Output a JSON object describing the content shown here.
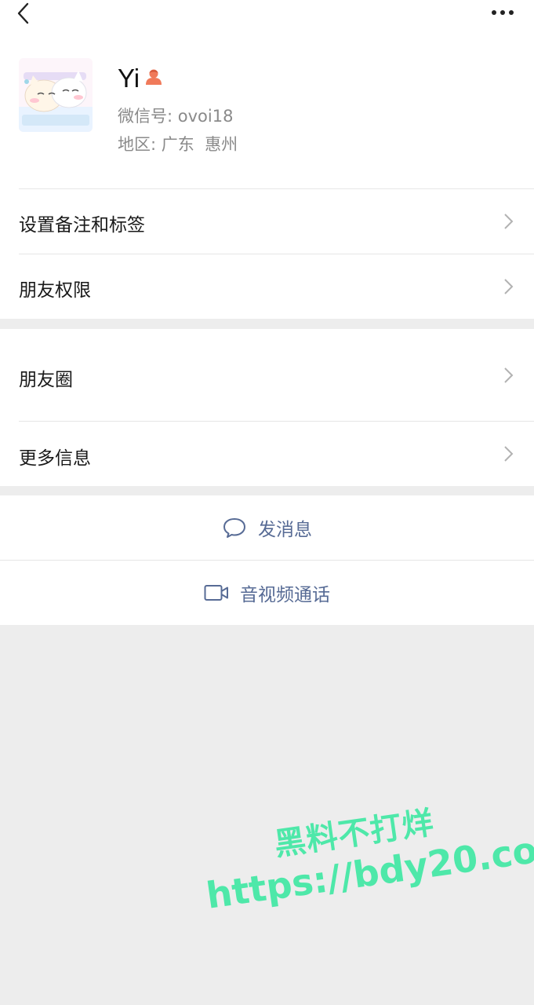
{
  "profile": {
    "name": "Yi",
    "wechat_id_label": "微信号:",
    "wechat_id": "ovoi18",
    "region_label": "地区:",
    "region": "广东  惠州",
    "gender_icon": "female-icon",
    "gender_color": "#fa5151"
  },
  "settings": {
    "remarks_tags": "设置备注和标签",
    "friend_permissions": "朋友权限",
    "moments": "朋友圈",
    "more_info": "更多信息"
  },
  "actions": {
    "send_message": "发消息",
    "video_call": "音视频通话",
    "accent_color": "#576b95"
  },
  "watermark": {
    "line1": "黑料不打烊",
    "line2": "https://bdy20.co"
  }
}
